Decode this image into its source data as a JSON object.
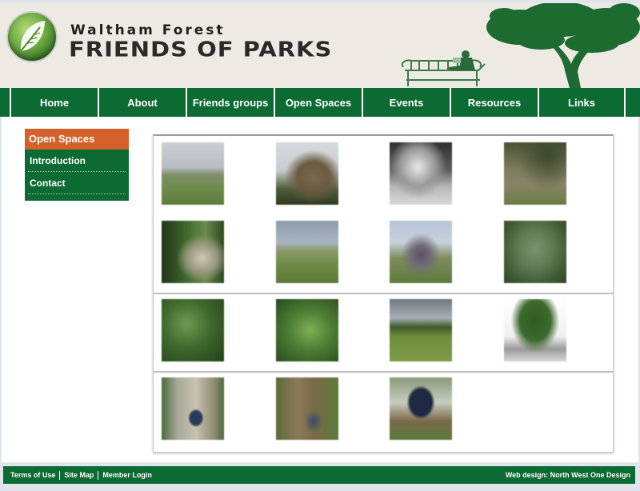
{
  "header": {
    "brand_top": "Waltham Forest",
    "brand_main": "FRIENDS OF PARKS",
    "logo_icon": "leaf-icon"
  },
  "nav": {
    "items": [
      "Home",
      "About",
      "Friends groups",
      "Open Spaces",
      "Events",
      "Resources",
      "Links"
    ]
  },
  "sidebar": {
    "title": "Open Spaces",
    "items": [
      "Introduction",
      "Contact"
    ]
  },
  "gallery": {
    "photos": [
      "grassland-path-photo",
      "bare-tree-photo",
      "mono-tree-photo",
      "woodland-floor-photo",
      "woodland-path-photo",
      "meadow-slope-photo",
      "group-walk-photo",
      "leafy-tree-photo",
      "dense-woods-photo",
      "woodland-clearing-photo",
      "open-meadow-photo",
      "large-tree-photo",
      "tree-plaque-photo",
      "ivy-trunk-photo",
      "memorial-sign-photo"
    ]
  },
  "footer": {
    "links": [
      "Terms of Use",
      "Site Map",
      "Member Login"
    ],
    "credit": "Web design: North West One Design"
  },
  "colors": {
    "brand_green": "#0c6a33",
    "accent_orange": "#d4602a",
    "header_bg": "#ede9e3"
  }
}
